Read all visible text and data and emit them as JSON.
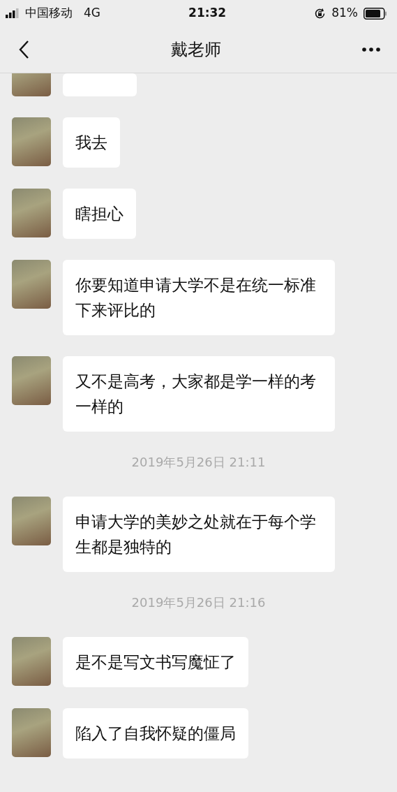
{
  "status_bar": {
    "carrier": "中国移动",
    "network": "4G",
    "time": "21:32",
    "battery": "81%"
  },
  "header": {
    "title": "戴老师"
  },
  "messages": [
    {
      "kind": "clipped"
    },
    {
      "kind": "message",
      "text": "我去"
    },
    {
      "kind": "message",
      "text": "瞎担心"
    },
    {
      "kind": "message",
      "text": "你要知道申请大学不是在统一标准下来评比的"
    },
    {
      "kind": "message",
      "text": "又不是高考，大家都是学一样的考一样的"
    },
    {
      "kind": "timestamp",
      "text": "2019年5月26日 21:11"
    },
    {
      "kind": "message",
      "text": "申请大学的美妙之处就在于每个学生都是独特的"
    },
    {
      "kind": "timestamp",
      "text": "2019年5月26日 21:16"
    },
    {
      "kind": "message",
      "text": "是不是写文书写魔怔了"
    },
    {
      "kind": "message",
      "text": "陷入了自我怀疑的僵局"
    }
  ]
}
